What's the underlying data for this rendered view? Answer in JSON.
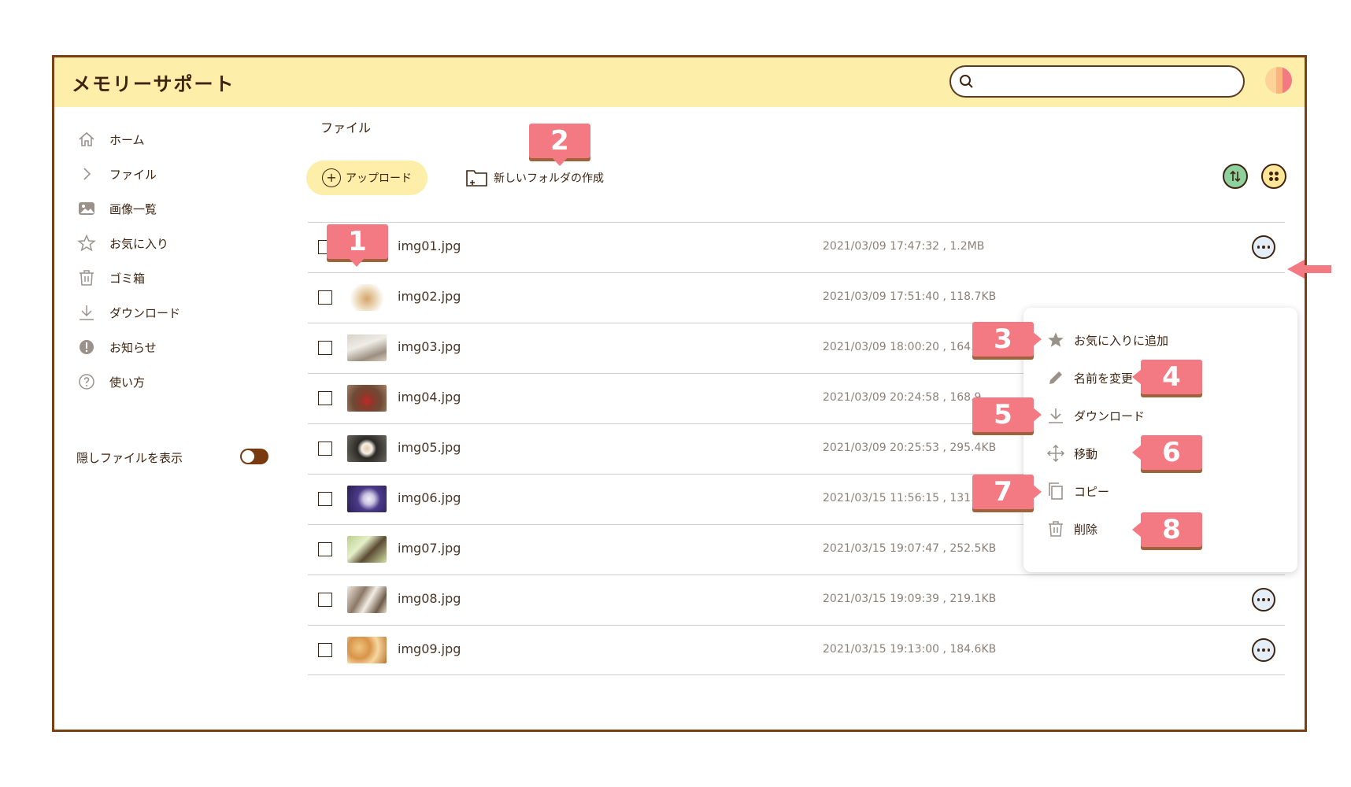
{
  "app": {
    "title": "メモリーサポート"
  },
  "search": {
    "placeholder": ""
  },
  "sidebar": {
    "items": [
      {
        "label": "ホーム",
        "icon": "home-icon"
      },
      {
        "label": "ファイル",
        "icon": "chevron-right-icon"
      },
      {
        "label": "画像一覧",
        "icon": "image-icon"
      },
      {
        "label": "お気に入り",
        "icon": "star-icon"
      },
      {
        "label": "ゴミ箱",
        "icon": "trash-icon"
      },
      {
        "label": "ダウンロード",
        "icon": "download-icon"
      },
      {
        "label": "お知らせ",
        "icon": "info-icon"
      },
      {
        "label": "使い方",
        "icon": "help-icon"
      }
    ],
    "hidden_files_label": "隠しファイルを表示",
    "hidden_files_toggle": "on"
  },
  "main": {
    "title": "ファイル",
    "upload_label": "アップロード",
    "new_folder_label": "新しいフォルダの作成"
  },
  "files": [
    {
      "name": "img01.jpg",
      "meta": "2021/03/09 17:47:32 , 1.2MB"
    },
    {
      "name": "img02.jpg",
      "meta": "2021/03/09 17:51:40 , 118.7KB"
    },
    {
      "name": "img03.jpg",
      "meta": "2021/03/09 18:00:20 , 164.8KB"
    },
    {
      "name": "img04.jpg",
      "meta": "2021/03/09 20:24:58 , 168.9"
    },
    {
      "name": "img05.jpg",
      "meta": "2021/03/09 20:25:53 , 295.4KB"
    },
    {
      "name": "img06.jpg",
      "meta": "2021/03/15 11:56:15 , 131.8KB"
    },
    {
      "name": "img07.jpg",
      "meta": "2021/03/15 19:07:47 , 252.5KB"
    },
    {
      "name": "img08.jpg",
      "meta": "2021/03/15 19:09:39 , 219.1KB"
    },
    {
      "name": "img09.jpg",
      "meta": "2021/03/15 19:13:00 , 184.6KB"
    }
  ],
  "context_menu": {
    "items": [
      {
        "label": "お気に入りに追加",
        "icon": "star-icon"
      },
      {
        "label": "名前を変更",
        "icon": "pencil-icon"
      },
      {
        "label": "ダウンロード",
        "icon": "download-icon"
      },
      {
        "label": "移動",
        "icon": "move-icon"
      },
      {
        "label": "コピー",
        "icon": "copy-icon"
      },
      {
        "label": "削除",
        "icon": "trash-icon"
      }
    ]
  },
  "callouts": [
    "1",
    "2",
    "3",
    "4",
    "5",
    "6",
    "7",
    "8"
  ],
  "colors": {
    "header_bg": "#fdeeaa",
    "frame_border": "#7a3f12",
    "callout": "#f37a82",
    "sort_button": "#8fd19e",
    "view_button": "#fde59a",
    "text_dark": "#3d2410"
  }
}
